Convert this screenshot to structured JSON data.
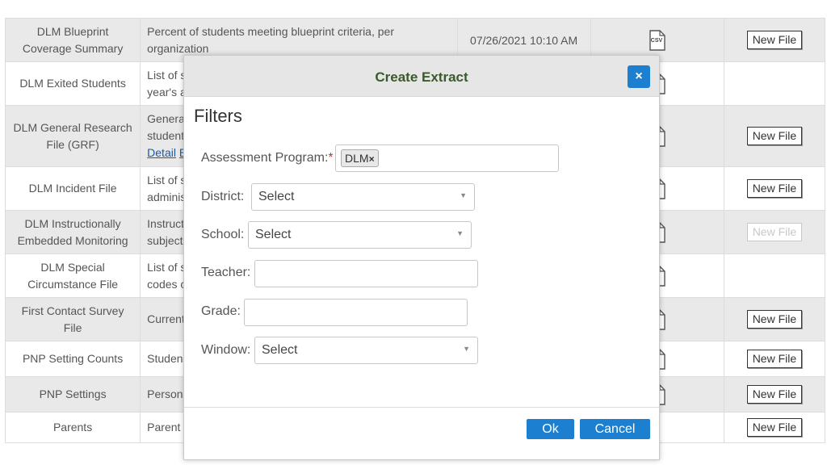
{
  "table": {
    "rows": [
      {
        "name": "DLM Blueprint Coverage Summary",
        "name_lines": [
          "DLM Blueprint",
          "Coverage Summary"
        ],
        "desc_lines": [
          "Percent of students meeting blueprint criteria, per",
          "organization"
        ],
        "date": "07/26/2021 10:10 AM",
        "icon": "csv-file-icon",
        "icon_text": "CSV",
        "button": "New File",
        "button_state": "enabled"
      },
      {
        "name": "DLM Exited Students",
        "name_lines": [
          "DLM Exited Students"
        ],
        "desc_lines": [
          "List of s",
          "year's a"
        ],
        "date": "",
        "icon": "file-icon",
        "icon_text": "",
        "button": "",
        "button_state": "none"
      },
      {
        "name": "DLM General Research File (GRF)",
        "name_lines": [
          "DLM General Research",
          "File (GRF)"
        ],
        "desc_lines": [
          "Genera",
          "student"
        ],
        "desc_links": [
          "Detail",
          "E"
        ],
        "date": "",
        "icon": "file-icon",
        "icon_text": "",
        "button": "New File",
        "button_state": "enabled"
      },
      {
        "name": "DLM Incident File",
        "name_lines": [
          "DLM Incident File"
        ],
        "desc_lines": [
          "List of s",
          "adminis"
        ],
        "date": "",
        "icon": "file-icon",
        "icon_text": "",
        "button": "New File",
        "button_state": "enabled"
      },
      {
        "name": "DLM Instructionally Embedded Monitoring",
        "name_lines": [
          "DLM Instructionally",
          "Embedded Monitoring"
        ],
        "desc_lines": [
          "Instruct",
          "subject"
        ],
        "date": "",
        "icon": "csv-file-icon",
        "icon_text": "",
        "button": "New File",
        "button_state": "disabled"
      },
      {
        "name": "DLM Special Circumstance File",
        "name_lines": [
          "DLM Special",
          "Circumstance File"
        ],
        "desc_lines": [
          "List of s",
          "codes c"
        ],
        "date": "",
        "icon": "file-icon",
        "icon_text": "",
        "button": "",
        "button_state": "none"
      },
      {
        "name": "First Contact Survey File",
        "name_lines": [
          "First Contact Survey",
          "File"
        ],
        "desc_lines": [
          "Current"
        ],
        "date": "",
        "icon": "csv-file-icon",
        "icon_text": "",
        "button": "New File",
        "button_state": "enabled"
      },
      {
        "name": "PNP Setting Counts",
        "name_lines": [
          "PNP Setting Counts"
        ],
        "desc_lines": [
          "Studen"
        ],
        "date": "",
        "icon": "csv-file-icon",
        "icon_text": "",
        "button": "New File",
        "button_state": "enabled"
      },
      {
        "name": "PNP Settings",
        "name_lines": [
          "PNP Settings"
        ],
        "desc_lines": [
          "Person"
        ],
        "date": "",
        "icon": "csv-file-icon",
        "icon_text": "",
        "button": "New File",
        "button_state": "enabled"
      },
      {
        "name": "Parents",
        "name_lines": [
          "Parents"
        ],
        "desc_lines": [
          "Parent"
        ],
        "date": "",
        "icon": "",
        "icon_text": "",
        "button": "New File",
        "button_state": "enabled"
      }
    ]
  },
  "modal": {
    "title": "Create Extract",
    "close_label": "×",
    "filters_heading": "Filters",
    "fields": {
      "assessment_program": {
        "label": "Assessment Program:",
        "required_mark": "*",
        "tag": "DLM",
        "tag_remove": "×"
      },
      "district": {
        "label": "District:",
        "value": "Select"
      },
      "school": {
        "label": "School:",
        "value": "Select"
      },
      "teacher": {
        "label": "Teacher:",
        "value": ""
      },
      "grade": {
        "label": "Grade:",
        "value": ""
      },
      "window": {
        "label": "Window:",
        "value": "Select"
      }
    },
    "ok_label": "Ok",
    "cancel_label": "Cancel"
  },
  "colors": {
    "accent": "#1c7fcf",
    "title": "#3b5a2a",
    "row_alt": "#e9e9e9",
    "required": "#c0392b"
  }
}
